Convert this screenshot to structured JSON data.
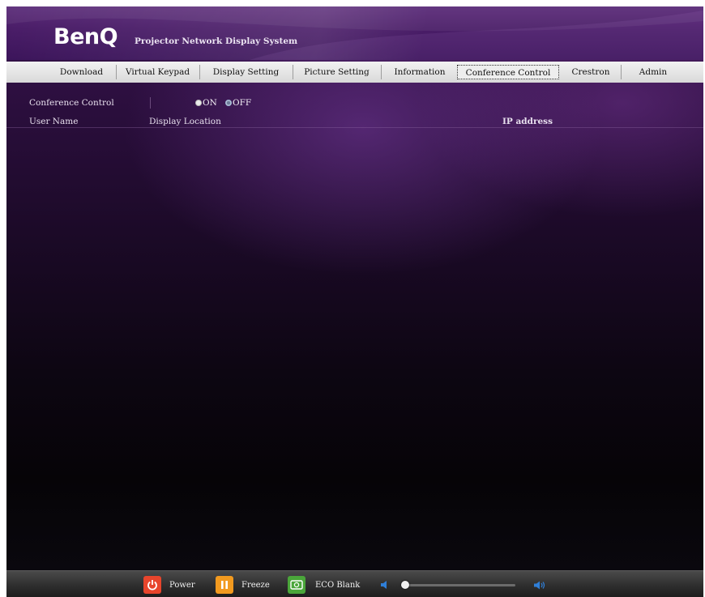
{
  "brand": {
    "logo": "BenQ",
    "system_title": "Projector Network Display System"
  },
  "tabs": [
    {
      "label": "Download",
      "active": false
    },
    {
      "label": "Virtual Keypad",
      "active": false
    },
    {
      "label": "Display Setting",
      "active": false
    },
    {
      "label": "Picture Setting",
      "active": false
    },
    {
      "label": "Information",
      "active": false
    },
    {
      "label": "Conference Control",
      "active": true
    },
    {
      "label": "Crestron",
      "active": false
    },
    {
      "label": "Admin",
      "active": false
    }
  ],
  "conference": {
    "label": "Conference Control",
    "on_label": "ON",
    "off_label": "OFF",
    "selected": "OFF"
  },
  "columns": {
    "user_name": "User Name",
    "display_location": "Display Location",
    "ip_address": "IP address"
  },
  "bottom_bar": {
    "power_label": "Power",
    "freeze_label": "Freeze",
    "eco_blank_label": "ECO Blank",
    "volume_level": 0.03
  },
  "colors": {
    "power": "#e8452c",
    "freeze": "#f29a1f",
    "eco_blank": "#4aa63a",
    "volume_icon": "#2f7fd8"
  }
}
